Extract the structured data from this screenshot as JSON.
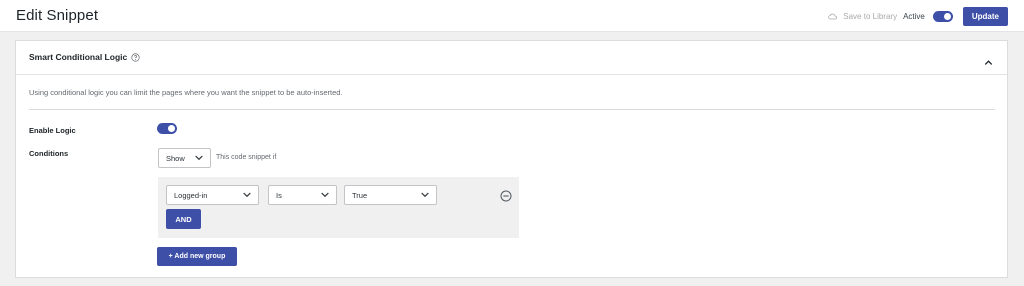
{
  "header": {
    "title": "Edit Snippet",
    "save_to_library": "Save to Library",
    "active_label": "Active",
    "active_on": true,
    "update_label": "Update"
  },
  "panel": {
    "title": "Smart Conditional Logic",
    "description": "Using conditional logic you can limit the pages where you want the snippet to be auto-inserted.",
    "enable_logic_label": "Enable Logic",
    "enable_logic_on": true,
    "conditions_label": "Conditions",
    "show_select": "Show",
    "show_text": "This code snippet if",
    "rule": {
      "field": "Logged-in",
      "operator": "Is",
      "value": "True"
    },
    "and_label": "AND",
    "add_group_label": "+ Add new group"
  },
  "colors": {
    "accent": "#3e4fa7",
    "background": "#f0f0f1"
  }
}
